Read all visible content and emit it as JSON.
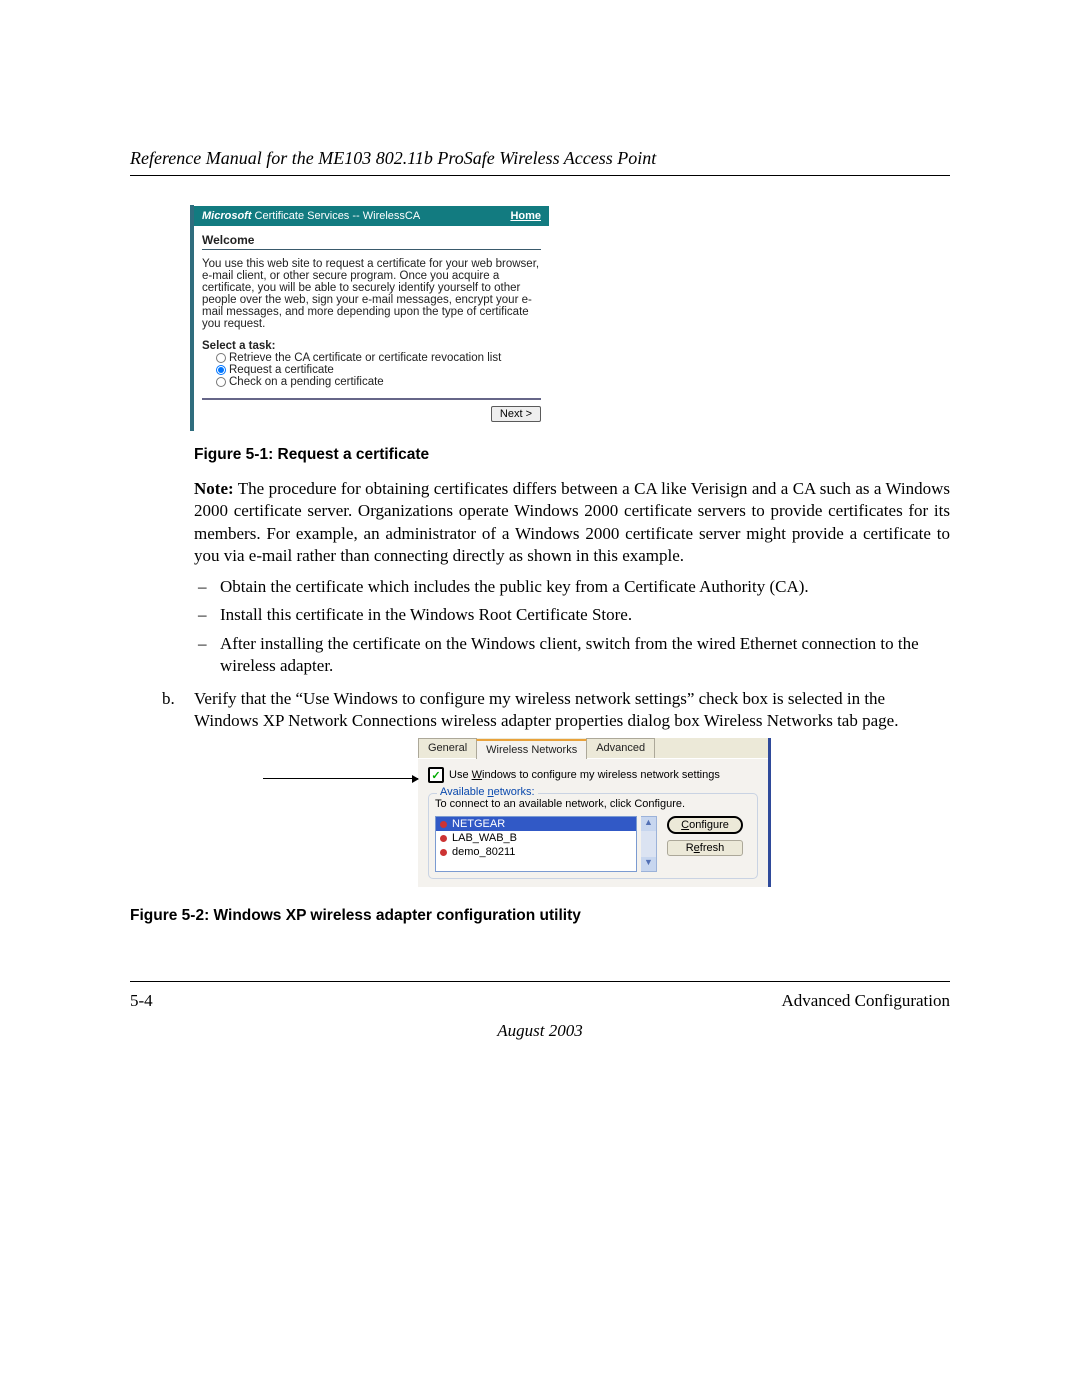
{
  "doc": {
    "title": "Reference Manual for the ME103 802.11b ProSafe Wireless Access Point"
  },
  "cert": {
    "header_left_ms": "Microsoft",
    "header_left_rest": " Certificate Services  --  WirelessCA",
    "header_home": "Home",
    "welcome": "Welcome",
    "intro": "You use this web site to request a certificate for your web browser, e-mail client, or other secure program. Once you acquire a certificate, you will be able to securely identify yourself to other people over the web, sign your e-mail messages, encrypt your e-mail messages, and more depending upon the type of certificate you request.",
    "select_task": "Select a task:",
    "radio1": "Retrieve the CA certificate or certificate revocation list",
    "radio2": "Request a certificate",
    "radio3": "Check on a pending certificate",
    "next": "Next >"
  },
  "fig1_caption": "Figure 5-1:  Request a certificate",
  "note": {
    "label": "Note:",
    "text": " The procedure for obtaining certificates differs between a CA like Verisign and a CA such as a Windows 2000 certificate server. Organizations operate Windows 2000 certificate servers to provide certificates for its members. For example, an administrator of a Windows 2000 certificate server might provide a certificate to you via e-mail rather than connecting directly as shown in this example."
  },
  "dashes": {
    "d1": "Obtain the certificate which includes the public key from a Certificate Authority (CA).",
    "d2": "Install this certificate in the Windows Root Certificate Store.",
    "d3": "After installing the certificate on the Windows client, switch from the wired Ethernet connection to the wireless adapter."
  },
  "b_item": "Verify that the “Use Windows to configure my wireless network settings” check box is selected in the Windows XP Network Connections wireless adapter properties dialog box Wireless Networks tab page.",
  "xp": {
    "tab_general": "General",
    "tab_wireless": "Wireless Networks",
    "tab_advanced": "Advanced",
    "checkbox_label": "Use Windows to configure my wireless network settings",
    "checkbox_accel_char": "W",
    "available_title": "Available networks:",
    "available_note": "To connect to an available network, click Configure.",
    "net1": "NETGEAR",
    "net2": "LAB_WAB_B",
    "net3": "demo_80211",
    "btn_configure": "Configure",
    "btn_refresh": "Refresh"
  },
  "fig2_caption": "Figure 5-2:  Windows XP wireless adapter configuration utility",
  "footer": {
    "page": "5-4",
    "section": "Advanced Configuration",
    "date": "August 2003"
  }
}
